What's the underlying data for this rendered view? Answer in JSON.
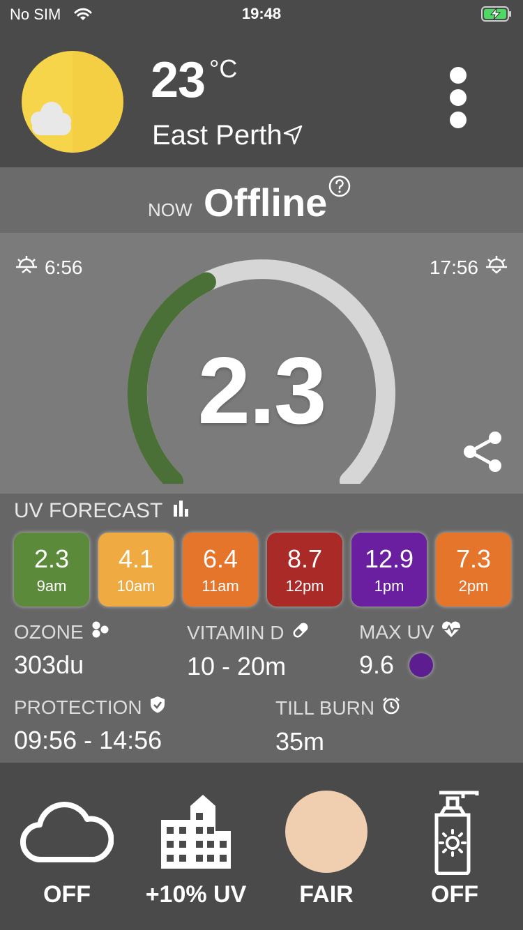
{
  "status_bar": {
    "carrier": "No SIM",
    "time": "19:48"
  },
  "header": {
    "temperature": "23",
    "unit": "°C",
    "location": "East Perth",
    "weather_icon": "partly-cloudy-sun-icon"
  },
  "now": {
    "label": "NOW",
    "status": "Offline"
  },
  "gauge": {
    "sunrise": "6:56",
    "sunset": "17:56",
    "uv_index": "2.3",
    "fill_fraction": 0.18,
    "fill_color": "#4a6f37",
    "track_color": "#d6d6d6"
  },
  "forecast": {
    "title": "UV FORECAST",
    "items": [
      {
        "value": "2.3",
        "time": "9am",
        "color": "#5b8a3a"
      },
      {
        "value": "4.1",
        "time": "10am",
        "color": "#efab42"
      },
      {
        "value": "6.4",
        "time": "11am",
        "color": "#e4752a"
      },
      {
        "value": "8.7",
        "time": "12pm",
        "color": "#a92a26"
      },
      {
        "value": "12.9",
        "time": "1pm",
        "color": "#6a1ea0"
      },
      {
        "value": "7.3",
        "time": "2pm",
        "color": "#e4752a"
      }
    ]
  },
  "stats": {
    "ozone": {
      "label": "OZONE",
      "value": "303du"
    },
    "vitamin_d": {
      "label": "VITAMIN D",
      "value": "10 - 20m"
    },
    "max_uv": {
      "label": "MAX UV",
      "value": "9.6",
      "color": "#5b1d8f"
    },
    "protection": {
      "label": "PROTECTION",
      "value": "09:56 - 14:56"
    },
    "till_burn": {
      "label": "TILL BURN",
      "value": "35m"
    }
  },
  "toolbar": {
    "cloud": {
      "label": "OFF"
    },
    "city": {
      "label": "+10% UV"
    },
    "skin": {
      "label": "FAIR",
      "color": "#f0cfb0"
    },
    "sunscreen": {
      "label": "OFF"
    }
  }
}
